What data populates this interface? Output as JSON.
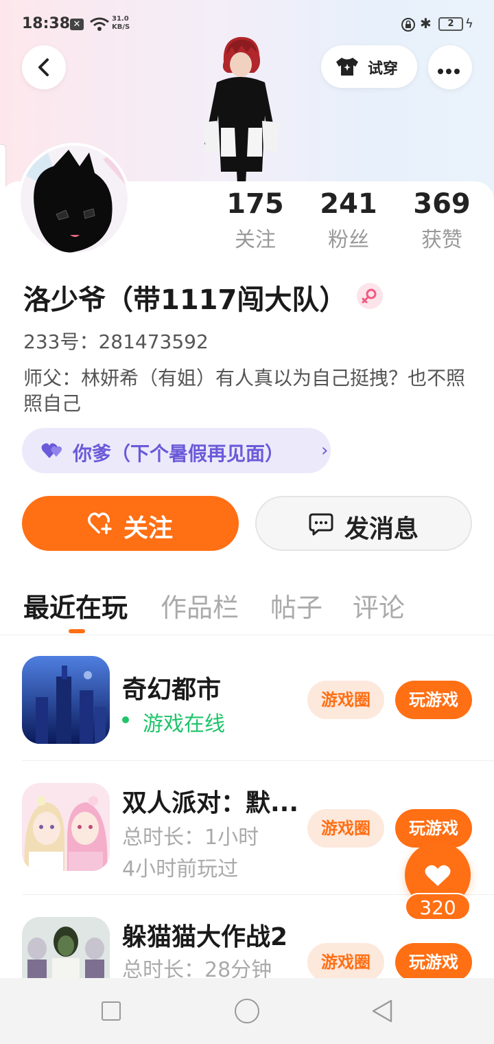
{
  "status_bar": {
    "time": "18:38",
    "net_speed_value": "31.0",
    "net_speed_unit": "KB/S",
    "battery": "2"
  },
  "header": {
    "try_on_label": "试穿"
  },
  "profile": {
    "stats": [
      {
        "value": "175",
        "label": "关注"
      },
      {
        "value": "241",
        "label": "粉丝"
      },
      {
        "value": "369",
        "label": "获赞"
      }
    ],
    "name": "洛少爷（带1117闯大队）",
    "id_line": "233号：281473592",
    "bio": "师父：林妍希（有姐）有人真以为自己挺拽？也不照照自己",
    "cp_tag": "你爹（下个暑假再见面）",
    "follow_label": "关注",
    "message_label": "发消息"
  },
  "tabs": [
    "最近在玩",
    "作品栏",
    "帖子",
    "评论"
  ],
  "games": [
    {
      "title": "奇幻都市",
      "line1": "游戏在线",
      "line2": "",
      "online": true,
      "circle_label": "游戏圈",
      "play_label": "玩游戏"
    },
    {
      "title": "双人派对：默...",
      "line1": "总时长：1小时",
      "line2": "4小时前玩过",
      "online": false,
      "circle_label": "游戏圈",
      "play_label": "玩游戏"
    },
    {
      "title": "躲猫猫大作战2",
      "line1": "总时长：28分钟",
      "line2": "",
      "online": false,
      "circle_label": "游戏圈",
      "play_label": "玩游戏"
    }
  ],
  "like_count": "320",
  "colors": {
    "accent": "#ff6f14",
    "online": "#1fc46b",
    "cp_text": "#6a5ad8",
    "cp_bg": "#ece9fb"
  },
  "icons": {
    "back": "chevron-left-icon",
    "try_on": "tshirt-icon",
    "more": "more-dots-icon",
    "gender": "female-icon",
    "cp": "double-heart-icon",
    "follow": "heart-plus-icon",
    "message": "chat-bubble-icon",
    "like": "heart-icon"
  }
}
